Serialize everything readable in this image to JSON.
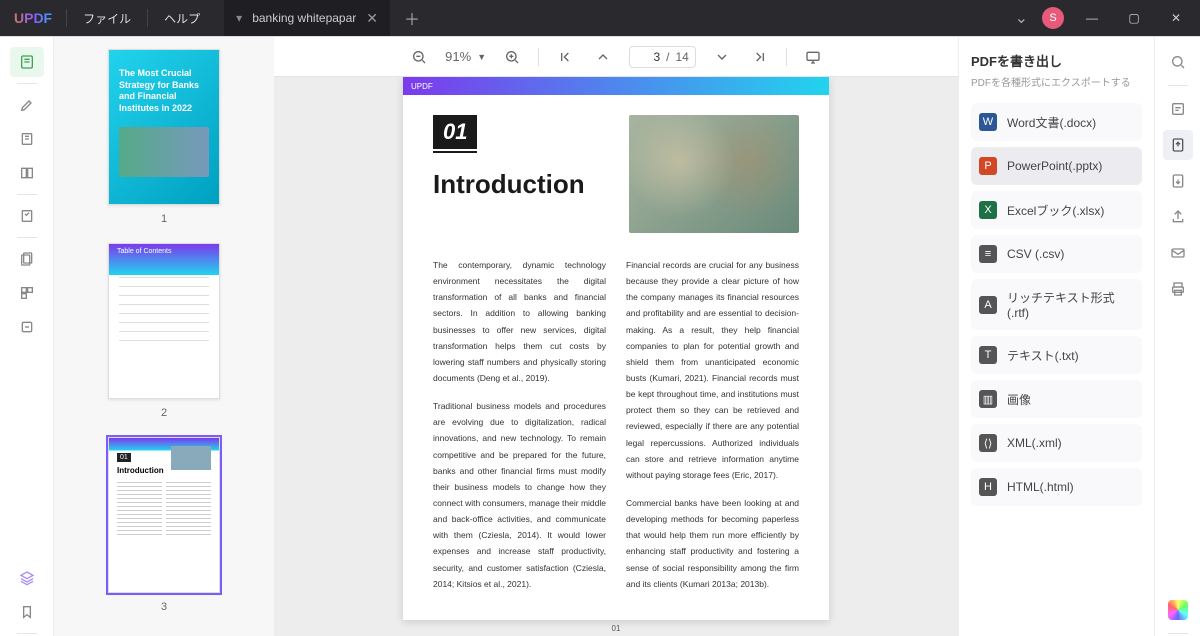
{
  "app": {
    "logo": "UPDF"
  },
  "menu": {
    "file": "ファイル",
    "help": "ヘルプ"
  },
  "tab": {
    "title": "banking whitepapar"
  },
  "avatar": {
    "initial": "S"
  },
  "toolbar": {
    "zoom": "91%",
    "page_current": "3",
    "page_sep": "/",
    "page_total": "14"
  },
  "thumbs": {
    "p1": {
      "label": "1",
      "cover_title": "The Most Crucial Strategy for Banks and Financial Institutes in 2022"
    },
    "p2": {
      "label": "2",
      "toc": "Table of Contents"
    },
    "p3": {
      "label": "3",
      "num": "01",
      "title": "Introduction"
    }
  },
  "doc": {
    "brand": "UPDF",
    "section_num": "01",
    "section_title": "Introduction",
    "col1p1": "The contemporary, dynamic technology environ­ment necessitates the digital transformation of all banks and financial sectors. In addition to allowing banking businesses to offer new services, digital transformation helps them cut costs by lowering staff numbers and physically storing documents (Deng et al., 2019).",
    "col1p2": "Traditional business models and procedures are evolving due to digitalization, radical innovations, and new technology. To remain competitive and be prepared for the future, banks and other financial firms must modify their business models to change how they connect with consumers, manage their middle and back-office activities, and communi­cate with them (Cziesla, 2014). It would lower expenses and increase staff productivity, security, and customer satisfaction (Cziesla, 2014; Kitsios et al., 2021).",
    "col2p1": "Financial records are crucial for any business because they provide a clear picture of how the company manages its financial resources and profitability and are essential to decision-making. As a result, they help financial companies to plan for potential growth and shield them from unantic­ipated economic busts (Kumari, 2021). Financial records must be kept throughout time, and institu­tions must protect them so they can be retrieved and reviewed, especially if there are any potential legal repercussions. Authorized individuals can store and retrieve information anytime without paying storage fees (Eric, 2017).",
    "col2p2": "Commercial banks have been looking at and developing methods for becoming paperless that would help them run more efficiently by enhanc­ing staff productivity and fostering a sense of social responsibility among the firm and its clients (Kumari 2013a; 2013b).",
    "page_num": "01"
  },
  "export": {
    "title": "PDFを書き出し",
    "subtitle": "PDFを各種形式にエクスポートする",
    "word": "Word文書(.docx)",
    "ppt": "PowerPoint(.pptx)",
    "xls": "Excelブック(.xlsx)",
    "csv": "CSV (.csv)",
    "rtf": "リッチテキスト形式(.rtf)",
    "txt": "テキスト(.txt)",
    "img": "画像",
    "xml": "XML(.xml)",
    "html": "HTML(.html)"
  }
}
